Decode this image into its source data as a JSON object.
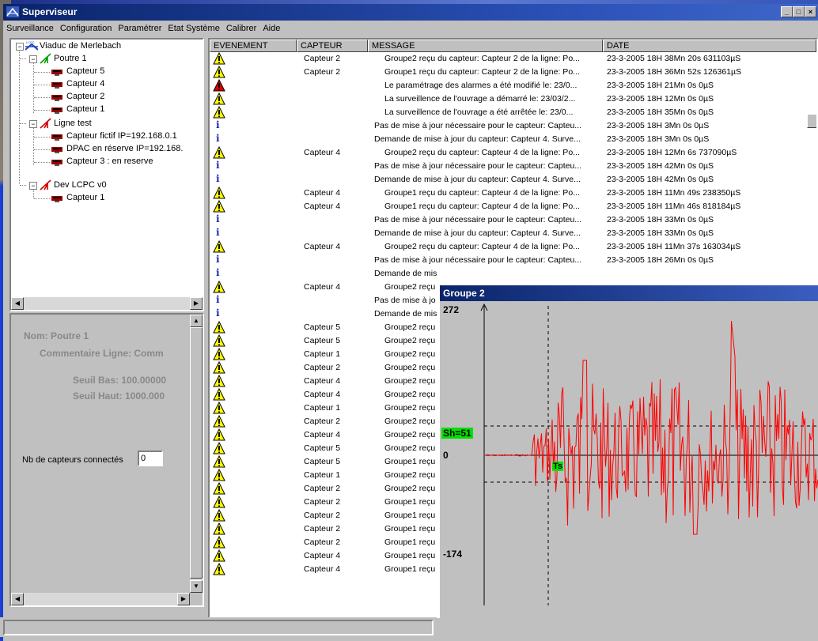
{
  "window": {
    "title": "Superviseur",
    "minimize": "_",
    "maximize": "□",
    "close": "×"
  },
  "menu": [
    "Surveillance",
    "Configuration",
    "Paramétrer",
    "Etat Système",
    "Calibrer",
    "Aide"
  ],
  "tree": {
    "root": "Viaduc de Merlebach",
    "root_badge": "LCPC",
    "groups": [
      {
        "label": "Poutre 1",
        "color": "#00a000",
        "items": [
          "Capteur 5",
          "Capteur 4",
          "Capteur 2",
          "Capteur 1"
        ]
      },
      {
        "label": "Ligne test",
        "color": "#d00000",
        "items": [
          "Capteur fictif   IP=192.168.0.1",
          "DPAC en réserve   IP=192.168.",
          "Capteur 3 : en reserve"
        ]
      },
      {
        "label": "Dev LCPC v0",
        "color": "#d00000",
        "items": [
          "Capteur 1"
        ]
      }
    ]
  },
  "properties": {
    "nom": "Nom: Poutre 1",
    "commentaire": "Commentaire Ligne: Comm",
    "seuil_bas": "Seuil Bas: 100.00000",
    "seuil_haut": "Seuil Haut: 1000.000",
    "nb_label": "Nb de capteurs connectés",
    "nb_value": "0"
  },
  "table": {
    "columns": [
      "EVENEMENT",
      "CAPTEUR",
      "MESSAGE",
      "DATE"
    ],
    "rows": [
      {
        "t": "w",
        "c": "Capteur 2",
        "m": "Groupe2 reçu du capteur: Capteur 2 de la ligne: Po...",
        "d": "23-3-2005 18H 38Mn 20s 631103µS",
        "i": true
      },
      {
        "t": "w",
        "c": "Capteur 2",
        "m": "Groupe1 reçu du capteur: Capteur 2 de la ligne: Po...",
        "d": "23-3-2005 18H 36Mn 52s 126361µS",
        "i": true
      },
      {
        "t": "a",
        "c": "",
        "m": "Le paramétrage des alarmes a été modifié le:  23/0...",
        "d": "23-3-2005 18H 21Mn 0s 0µS",
        "i": true
      },
      {
        "t": "w",
        "c": "",
        "m": "La surveillence de l'ouvrage a démarré le:  23/03/2...",
        "d": "23-3-2005 18H 12Mn 0s 0µS",
        "i": true
      },
      {
        "t": "w",
        "c": "",
        "m": "La surveillence de l'ouvrage a été arrêtée le:  23/0...",
        "d": "23-3-2005 18H 35Mn 0s 0µS",
        "i": true
      },
      {
        "t": "i",
        "c": "",
        "m": "Pas de mise à jour nécessaire pour le capteur: Capteu...",
        "d": "23-3-2005 18H 3Mn 0s 0µS",
        "i": false
      },
      {
        "t": "i",
        "c": "",
        "m": "Demande de mise à jour du capteur: Capteur 4. Surve...",
        "d": "23-3-2005 18H 3Mn 0s 0µS",
        "i": false
      },
      {
        "t": "w",
        "c": "Capteur 4",
        "m": "Groupe2 reçu du capteur: Capteur 4 de la ligne: Po...",
        "d": "23-3-2005 18H 12Mn 6s 737090µS",
        "i": true
      },
      {
        "t": "i",
        "c": "",
        "m": "Pas de mise à jour nécessaire pour le capteur: Capteu...",
        "d": "23-3-2005 18H 42Mn 0s 0µS",
        "i": false
      },
      {
        "t": "i",
        "c": "",
        "m": "Demande de mise à jour du capteur: Capteur 4. Surve...",
        "d": "23-3-2005 18H 42Mn 0s 0µS",
        "i": false
      },
      {
        "t": "w",
        "c": "Capteur 4",
        "m": "Groupe1 reçu du capteur: Capteur 4 de la ligne: Po...",
        "d": "23-3-2005 18H 11Mn 49s 238350µS",
        "i": true
      },
      {
        "t": "w",
        "c": "Capteur 4",
        "m": "Groupe1 reçu du capteur: Capteur 4 de la ligne: Po...",
        "d": "23-3-2005 18H 11Mn 46s 818184µS",
        "i": true
      },
      {
        "t": "i",
        "c": "",
        "m": "Pas de mise à jour nécessaire pour le capteur: Capteu...",
        "d": "23-3-2005 18H 33Mn 0s 0µS",
        "i": false
      },
      {
        "t": "i",
        "c": "",
        "m": "Demande de mise à jour du capteur: Capteur 4. Surve...",
        "d": "23-3-2005 18H 33Mn 0s 0µS",
        "i": false
      },
      {
        "t": "w",
        "c": "Capteur 4",
        "m": "Groupe2 reçu du capteur: Capteur 4 de la ligne: Po...",
        "d": "23-3-2005 18H 11Mn 37s 163034µS",
        "i": true
      },
      {
        "t": "i",
        "c": "",
        "m": "Pas de mise à jour nécessaire pour le capteur: Capteu...",
        "d": "23-3-2005 18H 26Mn 0s 0µS",
        "i": false
      },
      {
        "t": "i",
        "c": "",
        "m": "Demande de mis",
        "d": "",
        "i": false
      },
      {
        "t": "w",
        "c": "Capteur 4",
        "m": "Groupe2 reçu",
        "d": "",
        "i": true
      },
      {
        "t": "i",
        "c": "",
        "m": "Pas de mise à jo",
        "d": "",
        "i": false
      },
      {
        "t": "i",
        "c": "",
        "m": "Demande de mis",
        "d": "",
        "i": false
      },
      {
        "t": "w",
        "c": "Capteur 5",
        "m": "Groupe2 reçu",
        "d": "",
        "i": true
      },
      {
        "t": "w",
        "c": "Capteur 5",
        "m": "Groupe2 reçu",
        "d": "",
        "i": true
      },
      {
        "t": "w",
        "c": "Capteur 1",
        "m": "Groupe2 reçu",
        "d": "",
        "i": true
      },
      {
        "t": "w",
        "c": "Capteur 2",
        "m": "Groupe2 reçu",
        "d": "",
        "i": true
      },
      {
        "t": "w",
        "c": "Capteur 4",
        "m": "Groupe2 reçu",
        "d": "",
        "i": true
      },
      {
        "t": "w",
        "c": "Capteur 4",
        "m": "Groupe2 reçu",
        "d": "",
        "i": true
      },
      {
        "t": "w",
        "c": "Capteur 1",
        "m": "Groupe2 reçu",
        "d": "",
        "i": true
      },
      {
        "t": "w",
        "c": "Capteur 2",
        "m": "Groupe2 reçu",
        "d": "",
        "i": true
      },
      {
        "t": "w",
        "c": "Capteur 4",
        "m": "Groupe2 reçu",
        "d": "",
        "i": true
      },
      {
        "t": "w",
        "c": "Capteur 5",
        "m": "Groupe2 reçu",
        "d": "",
        "i": true
      },
      {
        "t": "w",
        "c": "Capteur 5",
        "m": "Groupe1 reçu",
        "d": "",
        "i": true
      },
      {
        "t": "w",
        "c": "Capteur 1",
        "m": "Groupe2 reçu",
        "d": "",
        "i": true
      },
      {
        "t": "w",
        "c": "Capteur 2",
        "m": "Groupe2 reçu",
        "d": "",
        "i": true
      },
      {
        "t": "w",
        "c": "Capteur 2",
        "m": "Groupe1 reçu",
        "d": "",
        "i": true
      },
      {
        "t": "w",
        "c": "Capteur 2",
        "m": "Groupe1 reçu",
        "d": "",
        "i": true
      },
      {
        "t": "w",
        "c": "Capteur 2",
        "m": "Groupe1 reçu",
        "d": "",
        "i": true
      },
      {
        "t": "w",
        "c": "Capteur 2",
        "m": "Groupe1 reçu",
        "d": "",
        "i": true
      },
      {
        "t": "w",
        "c": "Capteur 4",
        "m": "Groupe1 reçu",
        "d": "",
        "i": true
      },
      {
        "t": "w",
        "c": "Capteur 4",
        "m": "Groupe1 reçu",
        "d": "",
        "i": true
      }
    ]
  },
  "graph": {
    "title": "Groupe 2",
    "y_max": "272",
    "y_min": "-174",
    "zero": "0",
    "sh_label": "Sh=51",
    "ts_label": "Ts",
    "signal_color": "#ff0000",
    "highlight_color": "#00e000"
  }
}
